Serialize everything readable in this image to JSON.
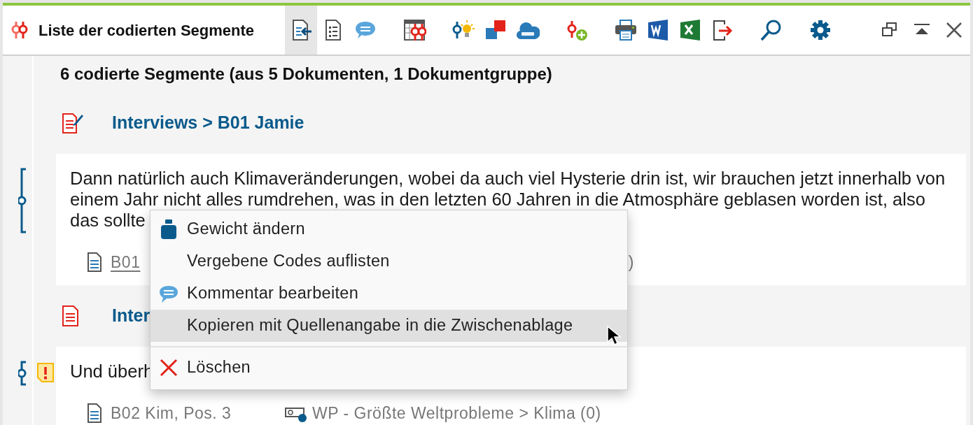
{
  "window": {
    "title": "Liste der codierten Segmente"
  },
  "toolbar_groups": [
    [
      {
        "kind": "import",
        "selected": true
      },
      {
        "kind": "list",
        "selected": false
      },
      {
        "kind": "comment",
        "selected": false
      }
    ],
    [
      {
        "kind": "code-table",
        "selected": false
      }
    ],
    [
      {
        "kind": "code-bulb",
        "selected": false
      },
      {
        "kind": "squares",
        "selected": false
      },
      {
        "kind": "cloud",
        "selected": false
      }
    ],
    [
      {
        "kind": "code-plus",
        "selected": false
      }
    ],
    [
      {
        "kind": "print",
        "selected": false
      },
      {
        "kind": "word",
        "selected": false
      },
      {
        "kind": "excel",
        "selected": false
      },
      {
        "kind": "export",
        "selected": false
      }
    ],
    [
      {
        "kind": "search",
        "selected": false
      }
    ],
    [
      {
        "kind": "settings",
        "selected": false
      }
    ]
  ],
  "window_controls": [
    {
      "kind": "restore"
    },
    {
      "kind": "collapse"
    },
    {
      "kind": "close"
    }
  ],
  "summary": "6 codierte Segmente (aus 5 Dokumenten, 1 Dokumentgruppe)",
  "groups": [
    {
      "document": "Interviews > B01 Jamie",
      "kind": "edited",
      "segment": {
        "lines": [
          "Dann natürlich auch Klimaveränderungen, wobei da auch viel Hysterie drin ist, wir brauchen jetzt innerhalb von",
          "einem Jahr nicht alles rumdrehen, was in den letzten 60 Jahren in die Atmosphäre geblasen worden ist, also",
          "das sollte"
        ],
        "kind": "bracket",
        "warning": false,
        "source": "B01",
        "source_link": true,
        "code": ")",
        "code_icon": false
      }
    },
    {
      "document": "Inter",
      "kind": "plain",
      "segment": {
        "lines": [
          "Und überh"
        ],
        "kind": "point",
        "warning": true,
        "source": "B02 Kim, Pos. 3",
        "source_link": false,
        "code": "WP - Größte Weltprobleme > Klima (0)",
        "code_icon": true
      }
    }
  ],
  "context_menu": {
    "items": [
      {
        "kind": "weight",
        "label": "Gewicht ändern",
        "selected": false
      },
      {
        "kind": "none",
        "label": "Vergebene Codes auflisten",
        "selected": false
      },
      {
        "kind": "comment",
        "label": "Kommentar bearbeiten",
        "selected": false
      },
      {
        "kind": "none",
        "label": "Kopieren mit Quellenangabe in die Zwischenablage",
        "selected": true
      },
      {
        "kind": "separator"
      },
      {
        "kind": "delete",
        "label": "Löschen",
        "selected": false
      }
    ]
  }
}
